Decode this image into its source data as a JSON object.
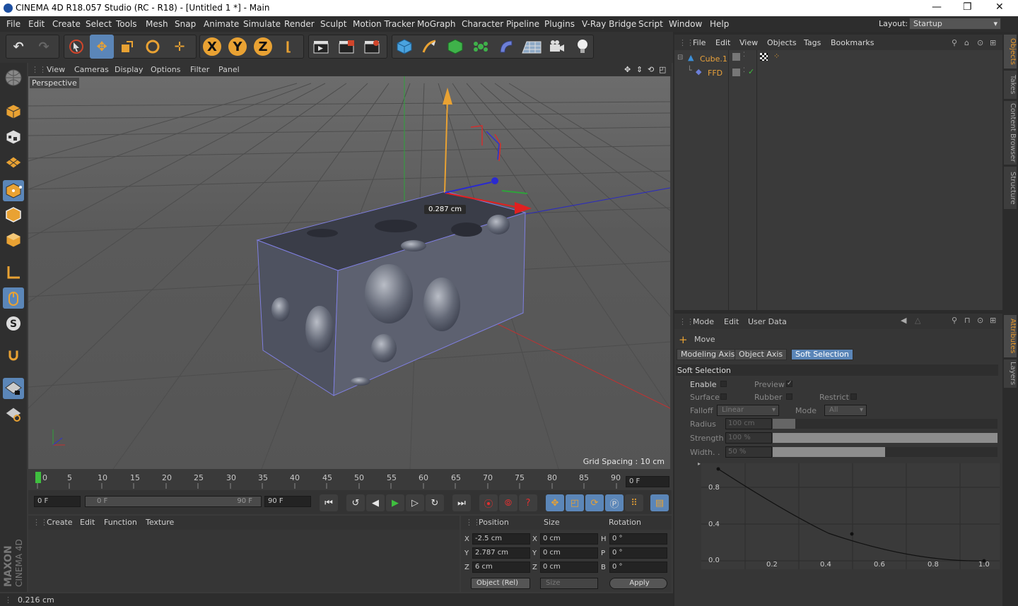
{
  "titlebar": {
    "title": "CINEMA 4D R18.057 Studio (RC - R18) - [Untitled 1 *] - Main"
  },
  "menu": [
    "File",
    "Edit",
    "Create",
    "Select",
    "Tools",
    "Mesh",
    "Snap",
    "Animate",
    "Simulate",
    "Render",
    "Sculpt",
    "Motion Tracker",
    "MoGraph",
    "Character",
    "Pipeline",
    "Plugins",
    "V-Ray Bridge",
    "Script",
    "Window",
    "Help"
  ],
  "layout": {
    "label": "Layout:",
    "value": "Startup"
  },
  "toolbar": {
    "x_label": "X",
    "y_label": "Y",
    "z_label": "Z"
  },
  "viewport": {
    "menu": [
      "View",
      "Cameras",
      "Display",
      "Options",
      "Filter",
      "Panel"
    ],
    "camera": "Perspective",
    "grid_spacing": "Grid Spacing : 10 cm",
    "dimension": "0.287 cm"
  },
  "timeline": {
    "ticks": [
      "0",
      "5",
      "10",
      "15",
      "20",
      "25",
      "30",
      "35",
      "40",
      "45",
      "50",
      "55",
      "60",
      "65",
      "70",
      "75",
      "80",
      "85",
      "90"
    ],
    "current": "0 F",
    "start": "0 F",
    "range_start": "0 F",
    "range_end": "90 F",
    "end": "90 F"
  },
  "material": {
    "menu": [
      "Create",
      "Edit",
      "Function",
      "Texture"
    ]
  },
  "coords": {
    "headers": [
      "Position",
      "Size",
      "Rotation"
    ],
    "pos": [
      {
        "axis": "X",
        "value": "-2.5 cm"
      },
      {
        "axis": "Y",
        "value": "2.787 cm"
      },
      {
        "axis": "Z",
        "value": "6 cm"
      }
    ],
    "size": [
      {
        "axis": "X",
        "value": "0 cm"
      },
      {
        "axis": "Y",
        "value": "0 cm"
      },
      {
        "axis": "Z",
        "value": "0 cm"
      }
    ],
    "rot": [
      {
        "axis": "H",
        "value": "0 °"
      },
      {
        "axis": "P",
        "value": "0 °"
      },
      {
        "axis": "B",
        "value": "0 °"
      }
    ],
    "mode": "Object (Rel)",
    "size_mode": "Size",
    "apply": "Apply"
  },
  "status": "0.216 cm",
  "brand": {
    "maxon": "MAXON",
    "c4d": "CINEMA 4D"
  },
  "objects": {
    "menu": [
      "File",
      "Edit",
      "View",
      "Objects",
      "Tags",
      "Bookmarks"
    ],
    "items": [
      {
        "name": "Cube.1",
        "color": "#e8a13b"
      },
      {
        "name": "FFD",
        "color": "#e8a13b"
      }
    ]
  },
  "attributes": {
    "menu": [
      "Mode",
      "Edit",
      "User Data"
    ],
    "tool": "Move",
    "tabs": [
      "Modeling Axis",
      "Object Axis",
      "Soft Selection"
    ],
    "section": "Soft Selection",
    "enable": "Enable",
    "preview": "Preview",
    "surface": "Surface",
    "rubber": "Rubber",
    "restrict": "Restrict",
    "falloff_label": "Falloff",
    "falloff_value": "Linear",
    "mode_label": "Mode",
    "mode_value": "All",
    "radius_label": "Radius",
    "radius_value": "100 cm",
    "radius_level": 0.1,
    "strength_label": "Strength",
    "strength_value": "100 %",
    "strength_level": 1.0,
    "width_label": "Width. .",
    "width_value": "50 %",
    "width_level": 0.5,
    "graph_y": [
      "0.8",
      "0.4",
      "0.0"
    ],
    "graph_x": [
      "0.2",
      "0.4",
      "0.6",
      "0.8",
      "1.0"
    ]
  },
  "side_tabs": [
    "Objects",
    "Takes",
    "Content Browser",
    "Structure",
    "Attributes",
    "Layers"
  ]
}
